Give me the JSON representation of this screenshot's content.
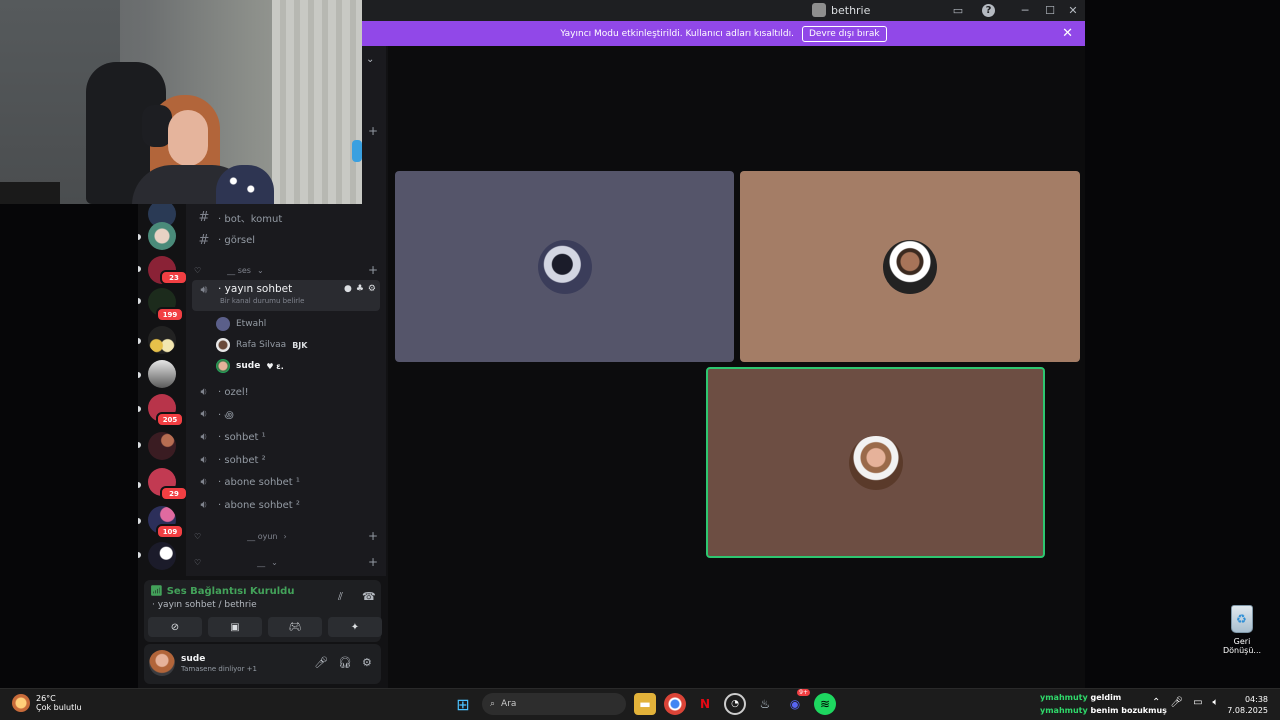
{
  "window": {
    "title": "bethrie",
    "banner_text": "Yayıncı Modu etkinleştirildi. Kullanıcı adları kısaltıldı.",
    "banner_button": "Devre dışı bırak"
  },
  "servers": [
    {
      "badge": ""
    },
    {
      "badge": ""
    },
    {
      "badge": "23"
    },
    {
      "badge": "199"
    },
    {
      "badge": ""
    },
    {
      "badge": ""
    },
    {
      "badge": "205"
    },
    {
      "badge": ""
    },
    {
      "badge": "29"
    },
    {
      "badge": "109"
    },
    {
      "badge": ""
    }
  ],
  "channels": {
    "text": [
      {
        "label": "· bot、komut"
      },
      {
        "label": "· görsel"
      }
    ],
    "category_ses": "__ ses",
    "active_voice": {
      "label": "· yayın sohbet",
      "status": "Bir kanal durumu belirle"
    },
    "voice_users": [
      {
        "name": "Etwahl",
        "tag": "",
        "color": "#5b5f8a"
      },
      {
        "name": "Rafa Silvaa",
        "tag": "BJK",
        "color": "#e9e9e9"
      },
      {
        "name": "sude",
        "tag": "♥ ε.",
        "color": "#c98d72"
      }
    ],
    "voice": [
      {
        "label": "· ozel!"
      },
      {
        "label": "· ꩜"
      },
      {
        "label": "· sohbet ¹"
      },
      {
        "label": "· sohbet ²"
      },
      {
        "label": "· abone sohbet ¹"
      },
      {
        "label": "· abone sohbet ²"
      }
    ],
    "category_oyun": "__ oyun",
    "category_blank": "__"
  },
  "voice_panel": {
    "status": "Ses Bağlantısı Kuruldu",
    "channel": "· yayın sohbet / bethrie"
  },
  "user": {
    "name": "sude",
    "activity": "Tamasene dinliyor +1"
  },
  "stage_tiles": [
    {
      "bg": "#55556a"
    },
    {
      "bg": "#a47d66"
    },
    {
      "bg": "#6d4e43",
      "speaking": true
    }
  ],
  "desktop": {
    "recycle_bin": "Geri Dönüşü..."
  },
  "taskbar": {
    "temp": "26°C",
    "weather": "Çok bulutlu",
    "search_placeholder": "Ara",
    "chat": [
      {
        "user": "ymahmuty",
        "message": "geldim"
      },
      {
        "user": "ymahmuty",
        "message": "benim bozukmuş"
      }
    ],
    "time": "04:38",
    "date": "7.08.2025",
    "discord_badge": "9+"
  }
}
